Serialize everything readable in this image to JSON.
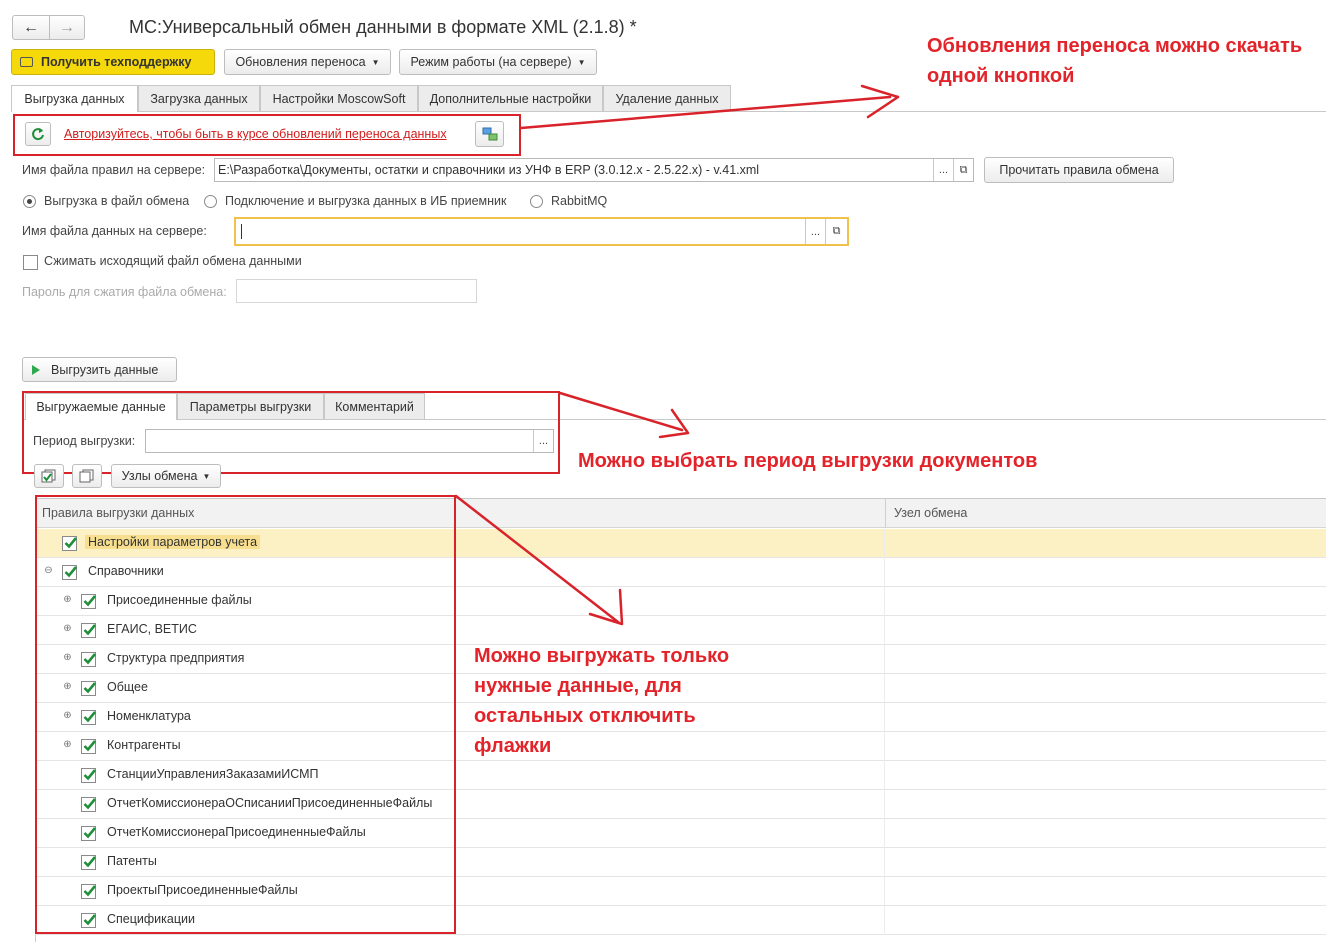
{
  "window": {
    "title": "МС:Универсальный обмен данными в формате XML (2.1.8) *",
    "nav_back": "←",
    "nav_forward": "→"
  },
  "toolbar": {
    "support_label": "Получить техподдержку",
    "updates_label": "Обновления переноса",
    "mode_label": "Режим работы (на сервере)"
  },
  "tabs": [
    {
      "label": "Выгрузка данных",
      "active": true
    },
    {
      "label": "Загрузка данных"
    },
    {
      "label": "Настройки MoscowSoft"
    },
    {
      "label": "Дополнительные настройки"
    },
    {
      "label": "Удаление данных"
    }
  ],
  "auth": {
    "link_text": "Авторизуйтесь, чтобы быть в курсе обновлений переноса данных"
  },
  "rules_file": {
    "label": "Имя файла правил на сервере:",
    "value": "E:\\Разработка\\Документы, остатки и справочники из УНФ в ERP (3.0.12.x - 2.5.22.x) - v.41.xml",
    "read_button": "Прочитать правила обмена",
    "select_glyph": "...",
    "open_glyph": "⧉"
  },
  "export_mode": {
    "options": [
      {
        "label": "Выгрузка в файл обмена",
        "selected": true
      },
      {
        "label": "Подключение и выгрузка данных в ИБ приемник",
        "selected": false
      },
      {
        "label": "RabbitMQ",
        "selected": false
      }
    ]
  },
  "data_file": {
    "label": "Имя файла данных на сервере:",
    "value": ""
  },
  "compress": {
    "label": "Сжимать исходящий файл обмена данными",
    "checked": false
  },
  "password": {
    "label": "Пароль для сжатия файла обмена:",
    "value": ""
  },
  "export_button": "Выгрузить данные",
  "inner_tabs": [
    {
      "label": "Выгружаемые данные",
      "active": true
    },
    {
      "label": "Параметры выгрузки"
    },
    {
      "label": "Комментарий"
    }
  ],
  "period": {
    "label": "Период выгрузки:",
    "value": ""
  },
  "nodes_button": "Узлы обмена",
  "table": {
    "columns": [
      "Правила выгрузки данных",
      "Узел обмена"
    ],
    "rows": [
      {
        "label": "Настройки параметров учета",
        "checked": true,
        "level": 0,
        "expander": "",
        "highlight": true
      },
      {
        "label": "Справочники",
        "checked": true,
        "level": 0,
        "expander": "⊖"
      },
      {
        "label": "Присоединенные файлы",
        "checked": true,
        "level": 1,
        "expander": "⊕"
      },
      {
        "label": "ЕГАИС, ВЕТИС",
        "checked": true,
        "level": 1,
        "expander": "⊕"
      },
      {
        "label": "Структура предприятия",
        "checked": true,
        "level": 1,
        "expander": "⊕"
      },
      {
        "label": "Общее",
        "checked": true,
        "level": 1,
        "expander": "⊕"
      },
      {
        "label": "Номенклатура",
        "checked": true,
        "level": 1,
        "expander": "⊕"
      },
      {
        "label": "Контрагенты",
        "checked": true,
        "level": 1,
        "expander": "⊕"
      },
      {
        "label": "СтанцииУправленияЗаказамиИСМП",
        "checked": true,
        "level": 1,
        "expander": ""
      },
      {
        "label": "ОтчетКомиссионераОСписанииПрисоединенныеФайлы",
        "checked": true,
        "level": 1,
        "expander": ""
      },
      {
        "label": "ОтчетКомиссионераПрисоединенныеФайлы",
        "checked": true,
        "level": 1,
        "expander": ""
      },
      {
        "label": "Патенты",
        "checked": true,
        "level": 1,
        "expander": ""
      },
      {
        "label": "ПроектыПрисоединенныеФайлы",
        "checked": true,
        "level": 1,
        "expander": ""
      },
      {
        "label": "Спецификации",
        "checked": true,
        "level": 1,
        "expander": ""
      }
    ]
  },
  "annotations": {
    "note1_line1": "Обновления переноса можно скачать",
    "note1_line2": "одной кнопкой",
    "note2": "Можно выбрать период выгрузки документов",
    "note3_line1": "Можно выгружать только",
    "note3_line2": "нужные данные, для",
    "note3_line3": "остальных отключить",
    "note3_line4": "флажки",
    "color": "#e3232a"
  },
  "colors": {
    "support_yellow": "#f5d90b",
    "highlight_row": "#fbf1c4",
    "active_field_border": "#f0c24c",
    "check_green": "#1f8f3a"
  }
}
